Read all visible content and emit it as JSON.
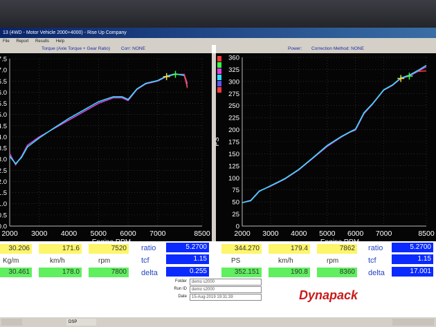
{
  "window": {
    "title": "13 (4WD - Motor Vehicle 2000+4000) - Rise Up Company",
    "menu": [
      "File",
      "Report",
      "Results",
      "Help"
    ]
  },
  "left_header": {
    "title": "Torque (Axle Torque + Gear Ratio)",
    "corr": "Corr: NONE"
  },
  "right_header": {
    "title": "Power:",
    "corr": "Correction Method: NONE"
  },
  "colors": {
    "trace_red": "#ff3a3a",
    "trace_green": "#3aff4a",
    "trace_magenta": "#e040e0",
    "trace_cyan": "#30e0ff",
    "trace_blue": "#5a5aff",
    "logo_red": "#c81a1a"
  },
  "chart_data": [
    {
      "type": "line",
      "title": "",
      "xlabel": "Engine RPM",
      "ylabel": "",
      "xlim": [
        2000,
        8500
      ],
      "ylim": [
        0,
        30
      ],
      "x_ticks": [
        "2000",
        "3000",
        "4000",
        "5000",
        "6000",
        "7000",
        "8500"
      ],
      "y_ticks": [
        "0.0",
        "0.5",
        "1.0",
        "1.5",
        "2.0",
        "2.5",
        "3.0",
        "3.5",
        "4.0",
        "4.5",
        "5.0",
        "5.5",
        "6.0",
        "6.5",
        "7.0",
        "7.5"
      ],
      "series": [
        {
          "x": [
            2000,
            2200,
            2400,
            2600,
            3000,
            3500,
            4000,
            4500,
            5000,
            5500,
            5800,
            6000,
            6300,
            6600,
            7000,
            7300,
            7600,
            7900,
            8000
          ],
          "values": [
            13,
            11,
            12.5,
            14.5,
            16,
            17.5,
            19,
            20.5,
            22,
            23,
            23,
            22.5,
            24.5,
            25.5,
            26,
            26.8,
            27.2,
            27.2,
            25.5
          ]
        },
        {
          "x": [
            2000,
            2200,
            2400,
            2600,
            3000,
            3500,
            4000,
            4500,
            5000,
            5500,
            5800,
            6000,
            6300,
            6600,
            7000,
            7300,
            7600,
            7900,
            8000
          ],
          "values": [
            12.5,
            11.2,
            12.3,
            14.2,
            15.8,
            17.6,
            19.3,
            20.8,
            22.3,
            23.2,
            23.2,
            22.7,
            24.6,
            25.6,
            26.1,
            26.9,
            27.3,
            27,
            25
          ]
        }
      ]
    },
    {
      "type": "line",
      "title": "",
      "xlabel": "Engine RPM",
      "ylabel": "PS",
      "xlim": [
        2000,
        8500
      ],
      "ylim": [
        0,
        360
      ],
      "x_ticks": [
        "2000",
        "3000",
        "4000",
        "5000",
        "6000",
        "7000",
        "8500"
      ],
      "y_ticks": [
        "0",
        "25",
        "50",
        "75",
        "100",
        "125",
        "150",
        "175",
        "200",
        "225",
        "250",
        "275",
        "300",
        "325",
        "360"
      ],
      "series": [
        {
          "x": [
            2000,
            2300,
            2600,
            3000,
            3500,
            4000,
            4500,
            5000,
            5500,
            5800,
            6000,
            6300,
            6600,
            7000,
            7300,
            7600,
            7900,
            8200,
            8500
          ],
          "values": [
            50,
            55,
            75,
            85,
            100,
            120,
            145,
            170,
            190,
            200,
            205,
            240,
            260,
            290,
            300,
            315,
            320,
            330,
            340
          ]
        },
        {
          "x": [
            2000,
            2300,
            2600,
            3000,
            3500,
            4000,
            4500,
            5000,
            5500,
            5800,
            6000,
            6300,
            6600,
            7000,
            7300,
            7600,
            7900,
            8200,
            8500
          ],
          "values": [
            50,
            54,
            74,
            86,
            101,
            121,
            146,
            172,
            191,
            201,
            207,
            242,
            261,
            291,
            301,
            316,
            322,
            332,
            343
          ]
        }
      ]
    }
  ],
  "readouts": {
    "left": {
      "kgm_1": "30.206",
      "kmh_1": "171.6",
      "rpm_1": "7520",
      "kgm_2": "30.461",
      "kmh_2": "178.0",
      "rpm_2": "7800",
      "unit_kgm": "Kg/m",
      "unit_kmh": "km/h",
      "unit_rpm": "rpm",
      "ratio_label": "ratio",
      "tcf_label": "tcf",
      "delta_label": "delta",
      "ratio": "5.2700",
      "tcf": "1.15",
      "delta": "0.255"
    },
    "right": {
      "ps_1": "344.270",
      "kmh_1": "179.4",
      "rpm_1": "7862",
      "ps_2": "352.151",
      "kmh_2": "190.8",
      "rpm_2": "8360",
      "unit_ps": "PS",
      "unit_kmh": "km/h",
      "unit_rpm": "rpm",
      "ratio_label": "ratio",
      "tcf_label": "tcf",
      "delta_label": "delta",
      "ratio": "5.2700",
      "tcf": "1.15",
      "delta": "17.001"
    }
  },
  "footer": {
    "folder_label": "Folder",
    "folder_value": "demo s2000",
    "runid_label": "Run ID",
    "runid_value": "demo s2000",
    "date_label": "Date",
    "date_value": "15-Aug-2019 19:31:39",
    "logo": "Dynapack"
  },
  "taskbar": {
    "item": "DSP"
  }
}
